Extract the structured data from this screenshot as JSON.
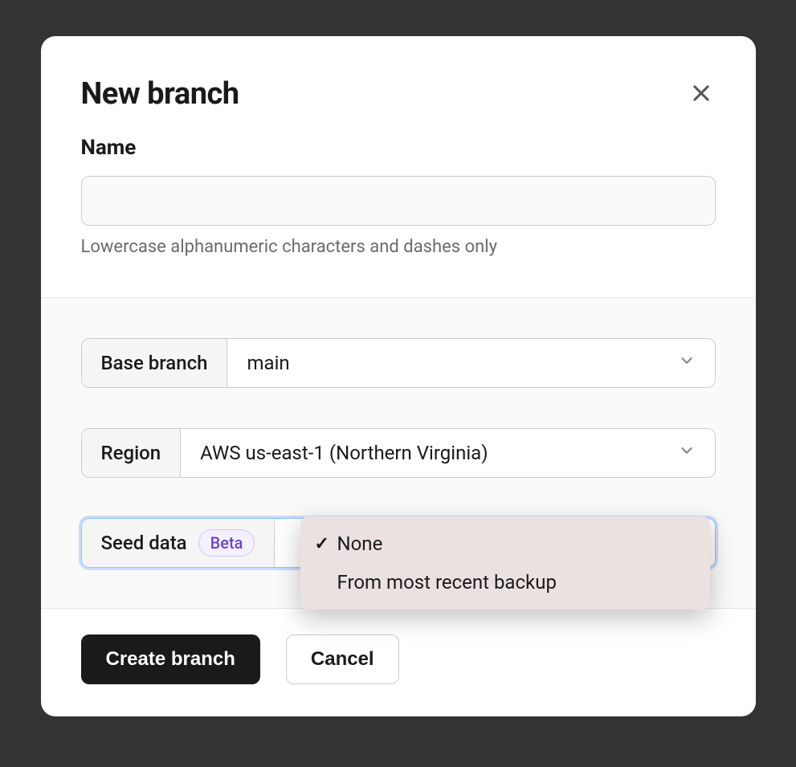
{
  "modal": {
    "title": "New branch",
    "name_section": {
      "label": "Name",
      "value": "",
      "help": "Lowercase alphanumeric characters and dashes only"
    },
    "base_branch": {
      "label": "Base branch",
      "value": "main"
    },
    "region": {
      "label": "Region",
      "value": "AWS us-east-1 (Northern Virginia)"
    },
    "seed_data": {
      "label": "Seed data",
      "badge": "Beta",
      "options": [
        {
          "label": "None",
          "selected": true
        },
        {
          "label": "From most recent backup",
          "selected": false
        }
      ]
    },
    "footer": {
      "primary": "Create branch",
      "secondary": "Cancel"
    }
  }
}
